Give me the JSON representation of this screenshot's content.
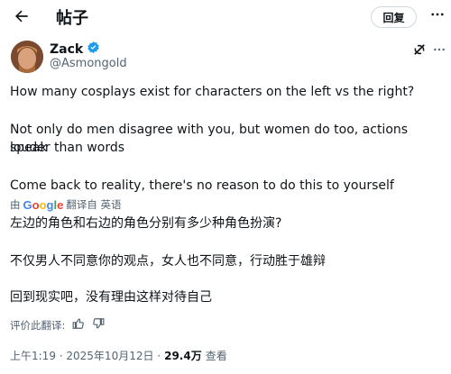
{
  "header": {
    "title": "帖子",
    "reply_label": "回复"
  },
  "author": {
    "name": "Zack",
    "handle": "@Asmongold",
    "verified": true
  },
  "tweet": {
    "lines": [
      "How many cosplays exist for characters on the left vs the right?",
      "Not only do men disagree with you, but women do too, actions speak",
      "louder than words",
      "Come back to reality, there's no reason to do this to yourself"
    ]
  },
  "translation_bar": {
    "prefix": "由",
    "provider": "Google",
    "suffix": "翻译自 英语"
  },
  "translation": {
    "lines": [
      "左边的角色和右边的角色分别有多少种角色扮演?",
      "不仅男人不同意你的观点，女人也不同意，行动胜于雄辩",
      "回到现实吧，没有理由这样对待自己"
    ]
  },
  "rating": {
    "label": "评价此翻译:"
  },
  "meta": {
    "time": "上午1:19 · 2025年10月12日 ·",
    "views": "29.4万",
    "views_label": "查看"
  },
  "colors": {
    "verified": "#1d9bf0",
    "secondary": "#536471",
    "google_blue": "#4285f4",
    "google_red": "#ea4335",
    "google_yellow": "#fbbc05",
    "google_green": "#34a853"
  }
}
